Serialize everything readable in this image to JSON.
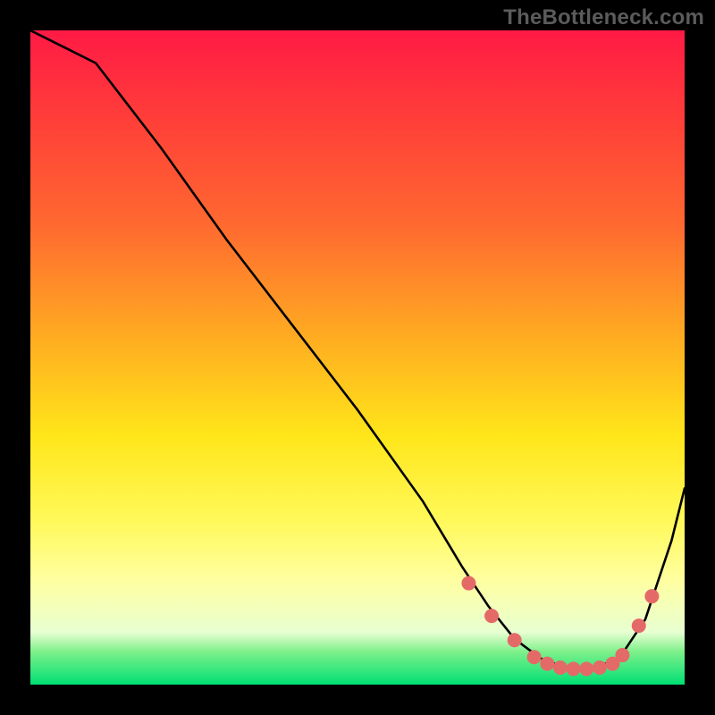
{
  "watermark": "TheBottleneck.com",
  "chart_data": {
    "type": "line",
    "title": "",
    "xlabel": "",
    "ylabel": "",
    "ylim": [
      0,
      100
    ],
    "xlim": [
      0,
      100
    ],
    "series": [
      {
        "name": "curve",
        "x": [
          0,
          6,
          10,
          20,
          30,
          40,
          50,
          60,
          66,
          70,
          74,
          78,
          82,
          86,
          90,
          94,
          98,
          100
        ],
        "y": [
          100,
          97,
          95,
          82,
          68,
          55,
          42,
          28,
          18,
          12,
          7,
          4,
          2.5,
          2.5,
          4,
          10,
          22,
          30
        ]
      }
    ],
    "markers": {
      "name": "points",
      "color": "#e46a68",
      "radius_px": 8,
      "x": [
        67,
        70.5,
        74,
        77,
        79,
        81,
        83,
        85,
        87,
        89,
        90.5,
        93,
        95
      ],
      "y": [
        15.5,
        10.5,
        6.8,
        4.2,
        3.2,
        2.6,
        2.4,
        2.4,
        2.6,
        3.2,
        4.5,
        9.0,
        13.5
      ]
    }
  }
}
